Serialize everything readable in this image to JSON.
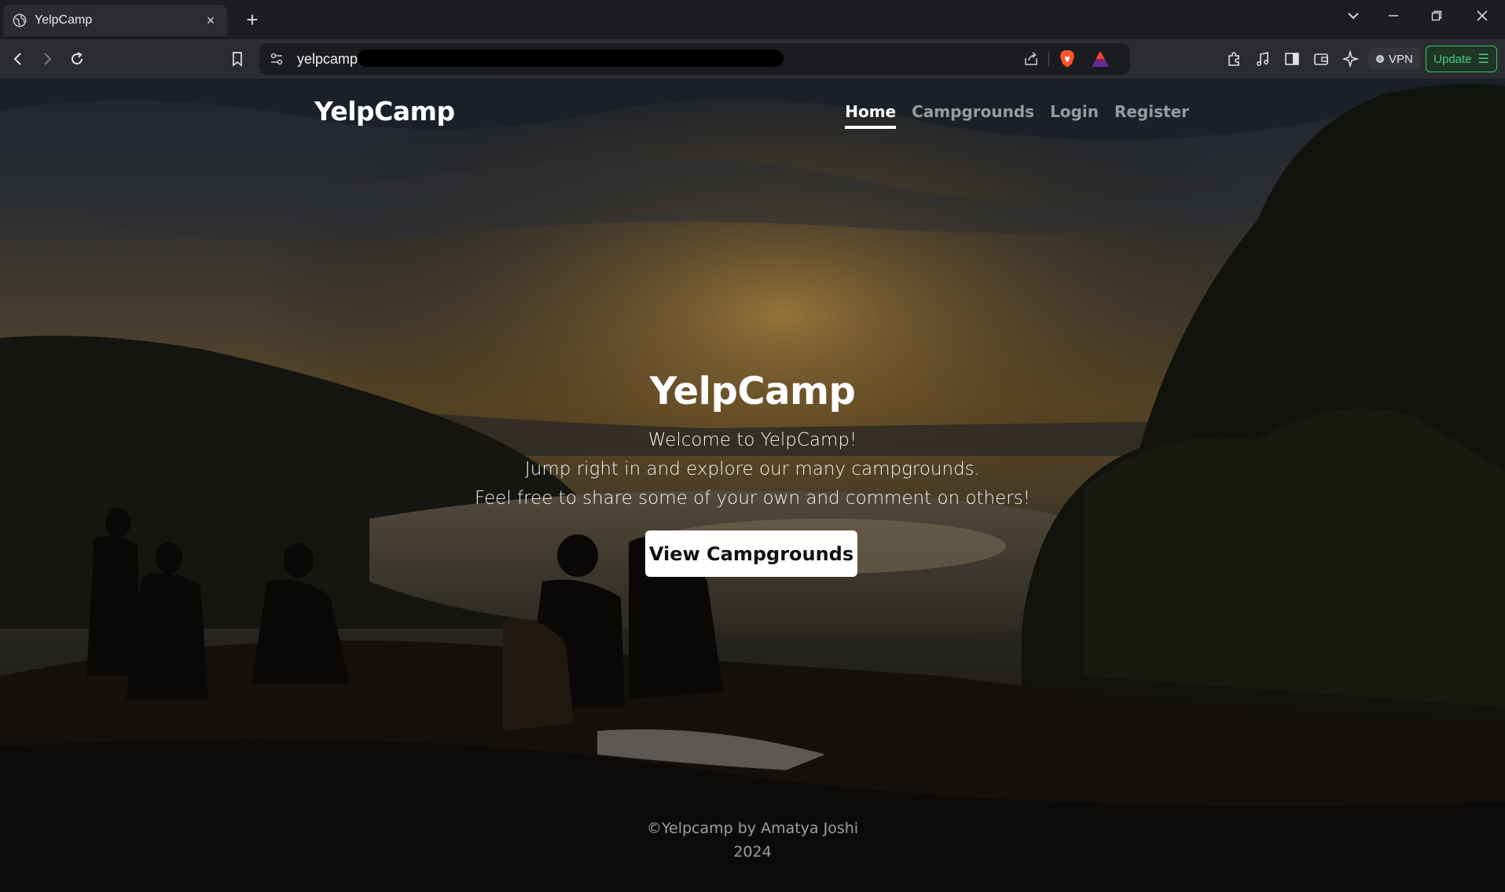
{
  "browser": {
    "tab_title": "YelpCamp",
    "tab_close": "×",
    "new_tab": "+",
    "url": "yelpcamp",
    "vpn_label": "VPN",
    "update_label": "Update",
    "window_controls": [
      "chevron-down",
      "minimize",
      "restore",
      "close"
    ]
  },
  "site": {
    "brand": "YelpCamp",
    "nav": [
      {
        "label": "Home",
        "active": true
      },
      {
        "label": "Campgrounds",
        "active": false
      },
      {
        "label": "Login",
        "active": false
      },
      {
        "label": "Register",
        "active": false
      }
    ]
  },
  "hero": {
    "title": "YelpCamp",
    "lines": [
      "Welcome to YelpCamp!",
      "Jump right in and explore our many campgrounds.",
      "Feel free to share some of your own and comment on others!"
    ],
    "cta": "View Campgrounds"
  },
  "footer": {
    "line1": "©Yelpcamp by Amatya Joshi",
    "line2": "2024"
  },
  "colors": {
    "update_accent": "#46d07a",
    "chrome_bg": "#2b2c31"
  }
}
